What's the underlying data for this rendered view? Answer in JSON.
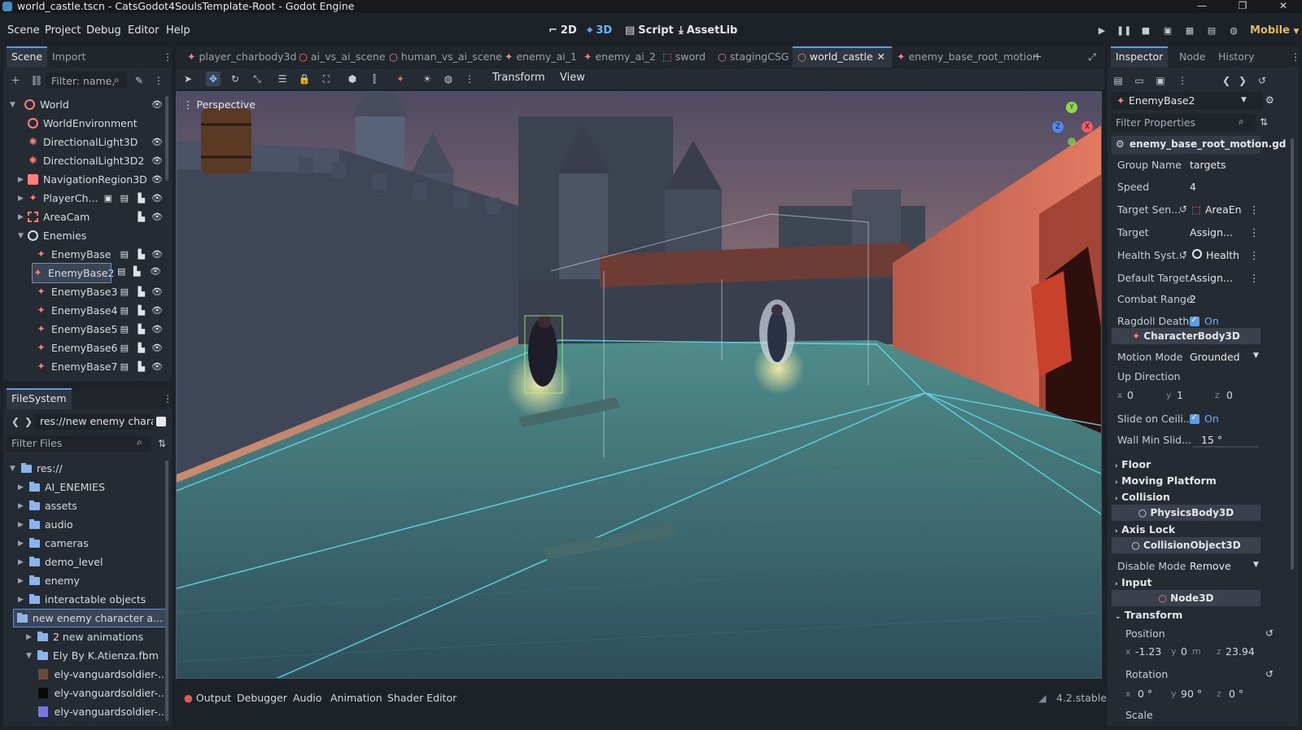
{
  "window": {
    "title": "world_castle.tscn - CatsGodot4SoulsTemplate-Root - Godot Engine"
  },
  "menu": {
    "items": [
      "Scene",
      "Project",
      "Debug",
      "Editor",
      "Help"
    ]
  },
  "modes": {
    "mode_2d": "2D",
    "mode_3d": "3D",
    "script": "Script",
    "assetlib": "AssetLib"
  },
  "renderer": "Mobile",
  "scene_panel": {
    "tabs": [
      "Scene",
      "Import"
    ],
    "filter_placeholder": "Filter: name,",
    "tree": [
      {
        "label": "World"
      },
      {
        "label": "WorldEnvironment"
      },
      {
        "label": "DirectionalLight3D"
      },
      {
        "label": "DirectionalLight3D2"
      },
      {
        "label": "NavigationRegion3D"
      },
      {
        "label": "PlayerCh..."
      },
      {
        "label": "AreaCam"
      },
      {
        "label": "Enemies"
      },
      {
        "label": "EnemyBase"
      },
      {
        "label": "EnemyBase2"
      },
      {
        "label": "EnemyBase3"
      },
      {
        "label": "EnemyBase4"
      },
      {
        "label": "EnemyBase5"
      },
      {
        "label": "EnemyBase6"
      },
      {
        "label": "EnemyBase7"
      }
    ]
  },
  "filesystem": {
    "tab": "FileSystem",
    "path": "res://new enemy charact",
    "filter_placeholder": "Filter Files",
    "items": [
      {
        "label": "res://"
      },
      {
        "label": "AI_ENEMIES"
      },
      {
        "label": "assets"
      },
      {
        "label": "audio"
      },
      {
        "label": "cameras"
      },
      {
        "label": "demo_level"
      },
      {
        "label": "enemy"
      },
      {
        "label": "interactable objects"
      },
      {
        "label": "new enemy character a..."
      },
      {
        "label": "2 new animations"
      },
      {
        "label": "Ely By K.Atienza.fbm"
      },
      {
        "label": "ely-vanguardsoldier-..."
      },
      {
        "label": "ely-vanguardsoldier-..."
      },
      {
        "label": "ely-vanguardsoldier-..."
      }
    ]
  },
  "scene_tabs": [
    "player_charbody3d",
    "ai_vs_ai_scene",
    "human_vs_ai_scene",
    "enemy_ai_1",
    "enemy_ai_2",
    "sword",
    "stagingCSG",
    "world_castle",
    "enemy_base_root_motion"
  ],
  "viewport_toolbar": {
    "transform": "Transform",
    "view": "View"
  },
  "viewport": {
    "perspective_label": "Perspective"
  },
  "inspector": {
    "tabs": [
      "Inspector",
      "Node",
      "History"
    ],
    "object": "EnemyBase2",
    "filter_placeholder": "Filter Properties",
    "script": "enemy_base_root_motion.gd",
    "props": {
      "group_name": {
        "name": "Group Name",
        "value": "targets"
      },
      "speed": {
        "name": "Speed",
        "value": "4"
      },
      "target_sensor": {
        "name": "Target Sen...",
        "value": "AreaEn"
      },
      "target": {
        "name": "Target",
        "value": "Assign..."
      },
      "health_system": {
        "name": "Health Syst...",
        "value": "Health"
      },
      "default_target": {
        "name": "Default Target",
        "value": "Assign..."
      },
      "combat_range": {
        "name": "Combat Range",
        "value": "2"
      },
      "ragdoll_death": {
        "name": "Ragdoll Death",
        "value": "On"
      }
    },
    "section_characterbody": "CharacterBody3D",
    "motion_mode": {
      "name": "Motion Mode",
      "value": "Grounded"
    },
    "up_direction": {
      "name": "Up Direction",
      "x": "0",
      "y": "1",
      "z": "0"
    },
    "slide_on_ceiling": {
      "name": "Slide on Ceili...",
      "value": "On"
    },
    "wall_min_slide": {
      "name": "Wall Min Slid...",
      "value": "15 °"
    },
    "groups": {
      "floor": "Floor",
      "moving_platform": "Moving Platform",
      "collision": "Collision",
      "axis_lock": "Axis Lock",
      "input": "Input",
      "transform": "Transform"
    },
    "section_physicsbody": "PhysicsBody3D",
    "section_collisionobject": "CollisionObject3D",
    "disable_mode": {
      "name": "Disable Mode",
      "value": "Remove"
    },
    "section_node3d": "Node3D",
    "position": {
      "name": "Position",
      "x": "-1.23",
      "y": "0",
      "y_unit": "m",
      "z": "23.94"
    },
    "rotation": {
      "name": "Rotation",
      "x": "0 °",
      "y": "90 °",
      "z": "0 °"
    },
    "scale": {
      "name": "Scale"
    }
  },
  "bottom": {
    "tabs": [
      "Output",
      "Debugger",
      "Audio",
      "Animation",
      "Shader Editor"
    ],
    "version": "4.2.stable"
  },
  "gizmo": {
    "x": "X",
    "y": "Y",
    "z": "Z"
  }
}
